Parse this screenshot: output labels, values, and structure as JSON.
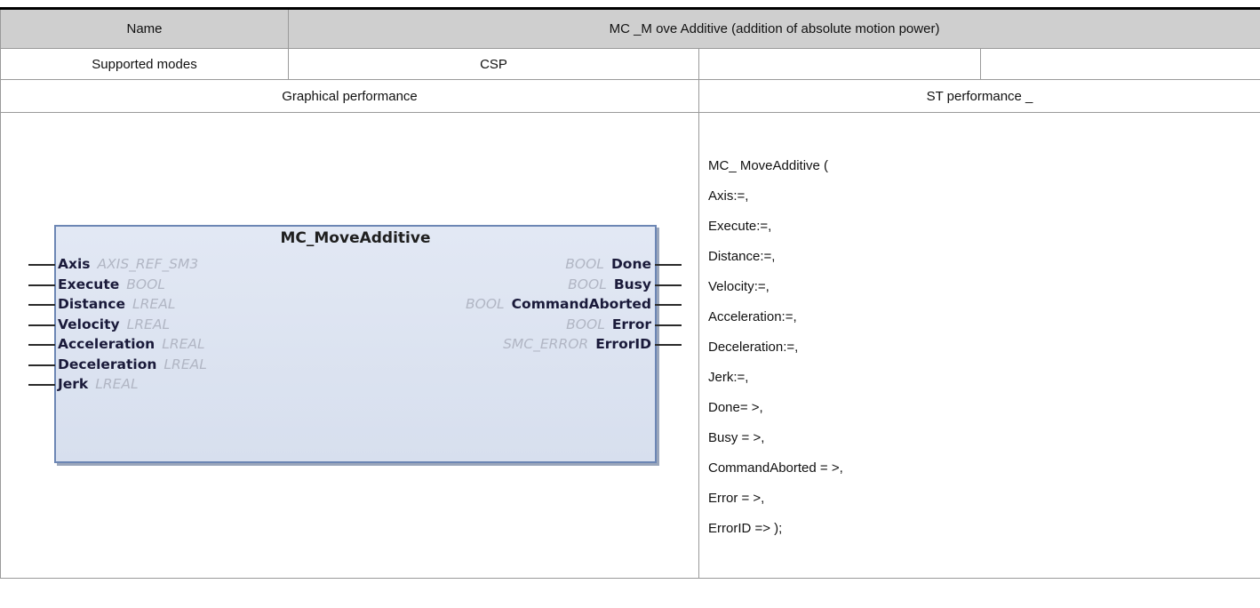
{
  "table": {
    "name_label": "Name",
    "name_value": "MC _M ove Additive (addition of absolute motion power)",
    "modes_label": "Supported modes",
    "modes_value": "CSP",
    "graphical_header": "Graphical performance",
    "st_header": "ST performance _"
  },
  "fb": {
    "title": "MC_MoveAdditive",
    "inputs": [
      {
        "name": "Axis",
        "type": "AXIS_REF_SM3"
      },
      {
        "name": "Execute",
        "type": "BOOL"
      },
      {
        "name": "Distance",
        "type": "LREAL"
      },
      {
        "name": "Velocity",
        "type": "LREAL"
      },
      {
        "name": "Acceleration",
        "type": "LREAL"
      },
      {
        "name": "Deceleration",
        "type": "LREAL"
      },
      {
        "name": "Jerk",
        "type": "LREAL"
      }
    ],
    "outputs": [
      {
        "name": "Done",
        "type": "BOOL"
      },
      {
        "name": "Busy",
        "type": "BOOL"
      },
      {
        "name": "CommandAborted",
        "type": "BOOL"
      },
      {
        "name": "Error",
        "type": "BOOL"
      },
      {
        "name": "ErrorID",
        "type": "SMC_ERROR"
      }
    ]
  },
  "st_lines": [
    "MC_ MoveAdditive (",
    "Axis:=,",
    "Execute:=,",
    "Distance:=,",
    "Velocity:=,",
    "Acceleration:=,",
    "Deceleration:=,",
    "Jerk:=,",
    "Done= >,",
    "Busy = >,",
    "CommandAborted = >,",
    "Error = >,",
    "ErrorID => );"
  ]
}
